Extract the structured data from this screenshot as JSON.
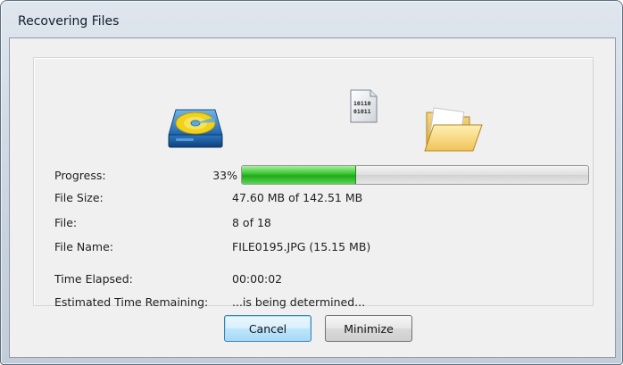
{
  "window": {
    "title": "Recovering Files"
  },
  "icons": {
    "source": "hard-disk-icon",
    "transfer": "binary-document-icon",
    "destination": "folder-icon"
  },
  "doc_icon_text": {
    "line1": "10110",
    "line2": "01011"
  },
  "progress": {
    "label": "Progress:",
    "percent_text": "33%",
    "fraction": 0.33
  },
  "details": {
    "file_size_label": "File Size:",
    "file_size_value": "47.60 MB of 142.51 MB",
    "file_label": "File:",
    "file_value": "8 of 18",
    "file_name_label": "File Name:",
    "file_name_value": "FILE0195.JPG (15.15 MB)",
    "time_elapsed_label": "Time Elapsed:",
    "time_elapsed_value": "00:00:02",
    "eta_label": "Estimated Time Remaining:",
    "eta_value": "...is being determined..."
  },
  "buttons": {
    "cancel": "Cancel",
    "minimize": "Minimize"
  },
  "colors": {
    "progress_green": "#35c42f",
    "default_button_border": "#3c7fb1"
  }
}
